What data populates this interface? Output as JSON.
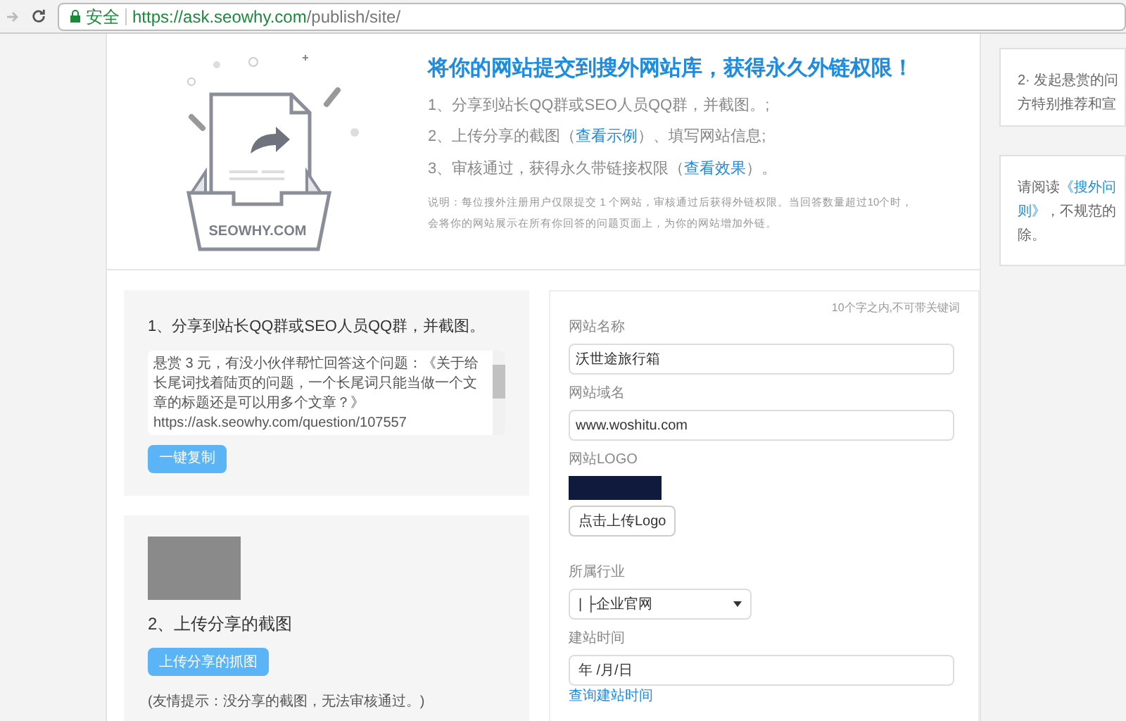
{
  "browser": {
    "secure_label": "安全",
    "url_host": "https://ask.seowhy.com",
    "url_path": "/publish/site/"
  },
  "hero": {
    "logo_text": "SEOWHY.COM",
    "title": "将你的网站提交到搜外网站库，获得永久外链权限！",
    "steps": [
      {
        "text": "1、分享到站长QQ群或SEO人员QQ群，并截图。;"
      },
      {
        "text": "2、上传分享的截图（",
        "link": "查看示例",
        "after": "）、填写网站信息;"
      },
      {
        "text": "3、审核通过，获得永久带链接权限（",
        "link": "查看效果",
        "after": "）。"
      }
    ],
    "notes": [
      "说明：每位搜外注册用户仅限提交 1 个网站，审核通过后获得外链权限。当回答数量超过10个时，",
      "会将你的网站展示在所有你回答的问题页面上，为你的网站增加外链。"
    ]
  },
  "share_card": {
    "title": "1、分享到站长QQ群或SEO人员QQ群，并截图。",
    "message": "悬赏 3 元，有没小伙伴帮忙回答这个问题：《关于给长尾词找着陆页的问题，一个长尾词只能当做一个文章的标题还是可以用多个文章？》\nhttps://ask.seowhy.com/question/107557",
    "button": "一键复制"
  },
  "upload_card": {
    "title": "2、上传分享的截图",
    "button": "上传分享的抓图",
    "hint": "(友情提示：没分享的截图，无法审核通过。)"
  },
  "form": {
    "hint": "10个字之内,不可带关键词",
    "name": {
      "label": "网站名称",
      "value": "沃世途旅行箱"
    },
    "domain": {
      "label": "网站域名",
      "value": "www.woshitu.com"
    },
    "logo": {
      "label": "网站LOGO",
      "button": "点击上传Logo"
    },
    "industry": {
      "label": "所属行业",
      "value": "| ├企业官网"
    },
    "date": {
      "label": "建站时间",
      "placeholder": "年 /月/日",
      "link": "查询建站时间"
    }
  },
  "sidebar": [
    {
      "lines": [
        [
          {
            "text": "2· 发起悬赏的问"
          }
        ],
        [
          {
            "text": "方特别推荐和宣"
          }
        ]
      ]
    },
    {
      "lines": [
        [
          {
            "text": "请阅读"
          },
          {
            "text": "《搜外问",
            "link": true
          }
        ],
        [
          {
            "text": "则》",
            "link": true
          },
          {
            "text": "，不规范的"
          }
        ],
        [
          {
            "text": "除。"
          }
        ]
      ]
    }
  ]
}
